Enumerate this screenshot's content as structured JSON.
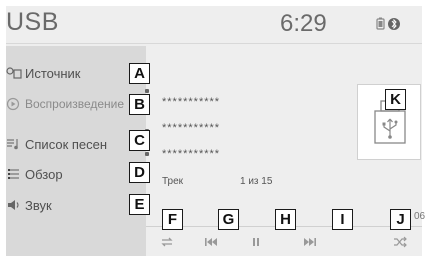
{
  "header": {
    "title": "USB",
    "time": "6:29"
  },
  "sidebar": {
    "items": [
      {
        "label": "Источник",
        "icon": "source-icon",
        "state": "normal"
      },
      {
        "label": "Воспроизведение",
        "icon": "play-circle-icon",
        "state": "dim"
      },
      {
        "label": "Список песен",
        "icon": "song-list-icon",
        "state": "normal"
      },
      {
        "label": "Обзор",
        "icon": "browse-icon",
        "state": "normal"
      },
      {
        "label": "Звук",
        "icon": "speaker-icon",
        "state": "normal"
      }
    ]
  },
  "main": {
    "lines": [
      "***********",
      "***********",
      "***********"
    ],
    "track_label": "Трек",
    "track_position": "1 из 15",
    "elapsed_fragment": "06"
  },
  "controls": [
    {
      "name": "repeat",
      "icon": "repeat-icon"
    },
    {
      "name": "previous",
      "icon": "previous-track-icon"
    },
    {
      "name": "pause",
      "icon": "pause-icon"
    },
    {
      "name": "next",
      "icon": "next-track-icon"
    },
    {
      "name": "shuffle",
      "icon": "shuffle-icon"
    }
  ],
  "callouts": [
    "A",
    "B",
    "C",
    "D",
    "E",
    "F",
    "G",
    "H",
    "I",
    "J",
    "K"
  ]
}
